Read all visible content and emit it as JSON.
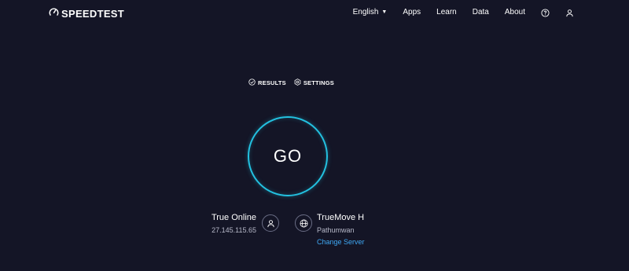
{
  "header": {
    "logo_text": "SPEEDTEST",
    "nav": {
      "language": "English",
      "apps": "Apps",
      "learn": "Learn",
      "data": "Data",
      "about": "About"
    },
    "icons": [
      "help-icon",
      "user-icon"
    ]
  },
  "subnav": {
    "results": "RESULTS",
    "settings": "SETTINGS"
  },
  "go_button": {
    "label": "GO"
  },
  "isp": {
    "name": "True Online",
    "ip": "27.145.115.65"
  },
  "server": {
    "name": "TrueMove H",
    "location": "Pathumwan",
    "change_label": "Change Server"
  },
  "colors": {
    "background": "#141526",
    "accent": "#23c1e0",
    "link": "#3fa9f5"
  }
}
